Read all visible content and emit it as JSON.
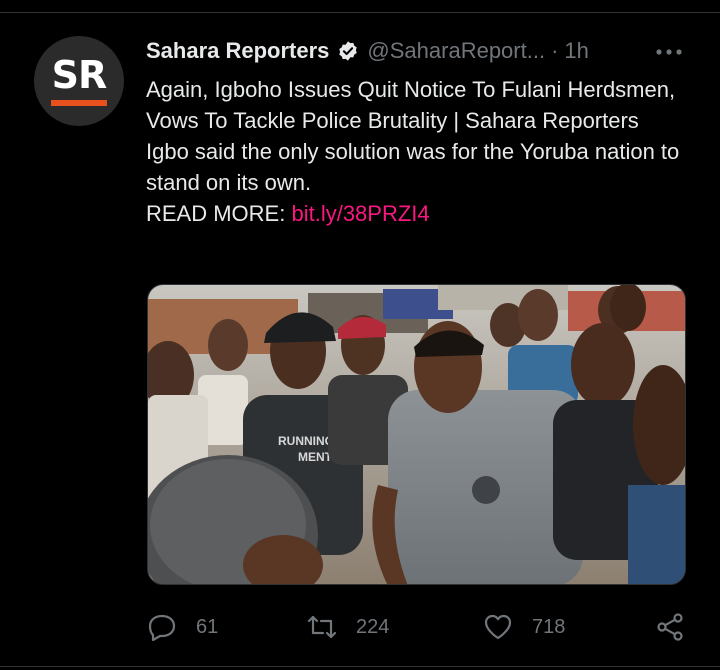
{
  "tweet": {
    "author": {
      "name": "Sahara Reporters",
      "handle": "@SaharaReport...",
      "avatar_text": "SR",
      "verified": true
    },
    "separator": "·",
    "time": "1h",
    "headline": "Again, Igboho Issues Quit Notice To Fulani Herdsmen, Vows To Tackle Police Brutality | Sahara Reporters",
    "body": "Igbo said the only solution was for the Yoruba nation to stand on its own.",
    "read_more_label": "READ MORE: ",
    "link_text": "bit.ly/38PRZI4",
    "image_shirt_text": "RUNNINGS\nMENT"
  },
  "actions": {
    "reply_count": "61",
    "retweet_count": "224",
    "like_count": "718"
  },
  "icons": {
    "verified": "verified-badge-icon",
    "more": "more-options-icon",
    "reply": "reply-icon",
    "retweet": "retweet-icon",
    "like": "heart-icon",
    "share": "share-icon"
  },
  "colors": {
    "background": "#000000",
    "text": "#e7e9ea",
    "muted": "#71767b",
    "link": "#f91880",
    "logo_accent": "#e8501e"
  }
}
